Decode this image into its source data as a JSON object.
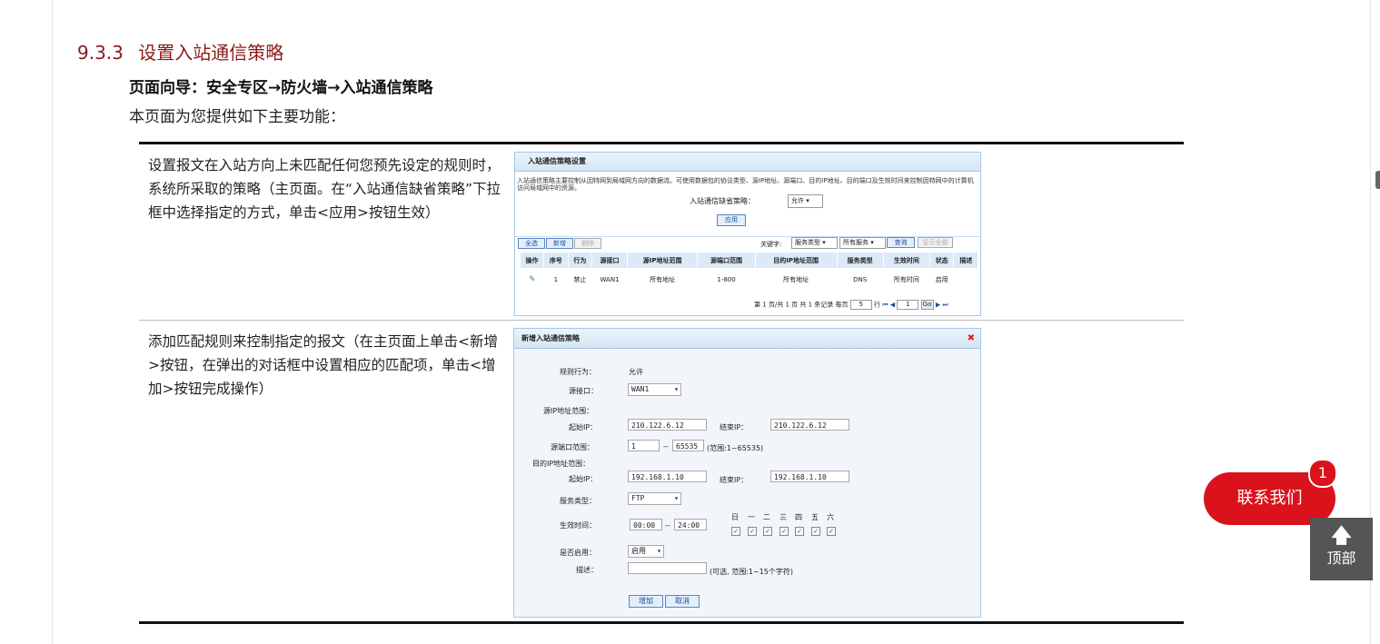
{
  "section": {
    "number": "9.3.3",
    "title": "设置入站通信策略"
  },
  "guide": "页面向导：安全专区→防火墙→入站通信策略",
  "intro": "本页面为您提供如下主要功能：",
  "rows": [
    {
      "text": "设置报文在入站方向上未匹配任何您预先设定的规则时，系统所采取的策略（主页面。在“入站通信缺省策略”下拉框中选择指定的方式，单击<应用>按钮生效）"
    },
    {
      "text": "添加匹配规则来控制指定的报文（在主页面上单击<新增>按钮，在弹出的对话框中设置相应的匹配项，单击<增加>按钮完成操作）"
    }
  ],
  "shot1": {
    "title": "入站通信策略设置",
    "desc": "入站通信策略主要控制从因特网到局域网方向的数据流。可使用数据包的协议类型、源IP地址、源端口、目的IP地址、目的端口及生效时间来控制因特网中的计算机访问局域网中的资源。",
    "default_label": "入站通信缺省策略：",
    "default_value": "允许",
    "apply": "应用",
    "btn_all": "全选",
    "btn_new": "新增",
    "btn_del": "删除",
    "keyword_label": "关键字:",
    "kw_sel1": "服务类型",
    "kw_sel2": "所有服务",
    "btn_query": "查询",
    "btn_showall": "显示全部",
    "headers": [
      "操作",
      "序号",
      "行为",
      "源接口",
      "源IP地址范围",
      "源端口范围",
      "目的IP地址范围",
      "服务类型",
      "生效时间",
      "状态",
      "描述"
    ],
    "rows": [
      [
        "",
        "1",
        "禁止",
        "WAN1",
        "所有地址",
        "1-800",
        "所有地址",
        "DNS",
        "所有时间",
        "启用",
        ""
      ]
    ],
    "pager": {
      "text1": "第 1 页/共 1 页 共 1 条记录 每页",
      "per_page": "5",
      "text2": "行",
      "page": "1",
      "go": "Go"
    }
  },
  "shot2": {
    "title": "新增入站通信策略",
    "labels": {
      "action": "规则行为：",
      "src_if": "源接口：",
      "src_ip_range": "源IP地址范围：",
      "start_ip": "起始IP：",
      "end_ip": "结束IP：",
      "src_port": "源端口范围：",
      "dst_ip_range": "目的IP地址范围：",
      "start_ip2": "起始IP：",
      "end_ip2": "结束IP：",
      "service": "服务类型：",
      "time": "生效时间：",
      "enabled": "是否启用：",
      "desc": "描述："
    },
    "values": {
      "action": "允许",
      "src_if": "WAN1",
      "src_start_ip": "210.122.6.12",
      "src_end_ip": "210.122.6.12",
      "port_from": "1",
      "port_sep": "--",
      "port_to": "65535",
      "port_hint": "(范围:1~65535)",
      "dst_start_ip": "192.168.1.10",
      "dst_end_ip": "192.168.1.10",
      "service": "FTP",
      "time_from": "00:00",
      "time_sep": "--",
      "time_to": "24:00",
      "enabled": "启用",
      "desc": "",
      "desc_hint": "(可选, 范围:1~15个字符)"
    },
    "days": [
      "日",
      "一",
      "二",
      "三",
      "四",
      "五",
      "六"
    ],
    "days_checked": [
      true,
      true,
      true,
      true,
      true,
      true,
      true
    ],
    "btn_add": "增加",
    "btn_cancel": "取消"
  },
  "contact": {
    "label": "联系我们",
    "badge": "1"
  },
  "top": {
    "arrow": "🡅",
    "label": "顶部"
  },
  "colors": {
    "section_title": "#8b1a1a",
    "contact_bg": "#d9121b",
    "top_bg": "#555555",
    "accent_blue": "#1d4e96"
  }
}
